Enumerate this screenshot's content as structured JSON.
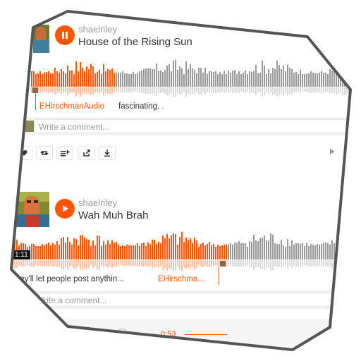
{
  "tracks": [
    {
      "user": "shaelriley",
      "title": "House of the Rising Sun",
      "play_state": "pause-icon",
      "progress": 0.26,
      "comment_user": "EHirschmanAudio",
      "comment_text": "fascinating. .",
      "comment_placeholder": "Write a comment..."
    },
    {
      "user": "shaelriley",
      "title": "Wah Muh Brah",
      "play_state": "play-icon",
      "progress": 0.66,
      "time": "1:11",
      "comment_text": "hey'll let people post anythin...",
      "comment_user": "EHirschma...",
      "comment_placeholder": "Write a comment...",
      "mini_time": "0:53"
    }
  ],
  "actions": [
    "like-icon",
    "repost-icon",
    "add-to-playlist-icon",
    "share-icon",
    "download-icon"
  ],
  "colors": {
    "accent": "#ff5500",
    "wave_played": "#ff5500",
    "wave_unplayed": "#999999"
  }
}
